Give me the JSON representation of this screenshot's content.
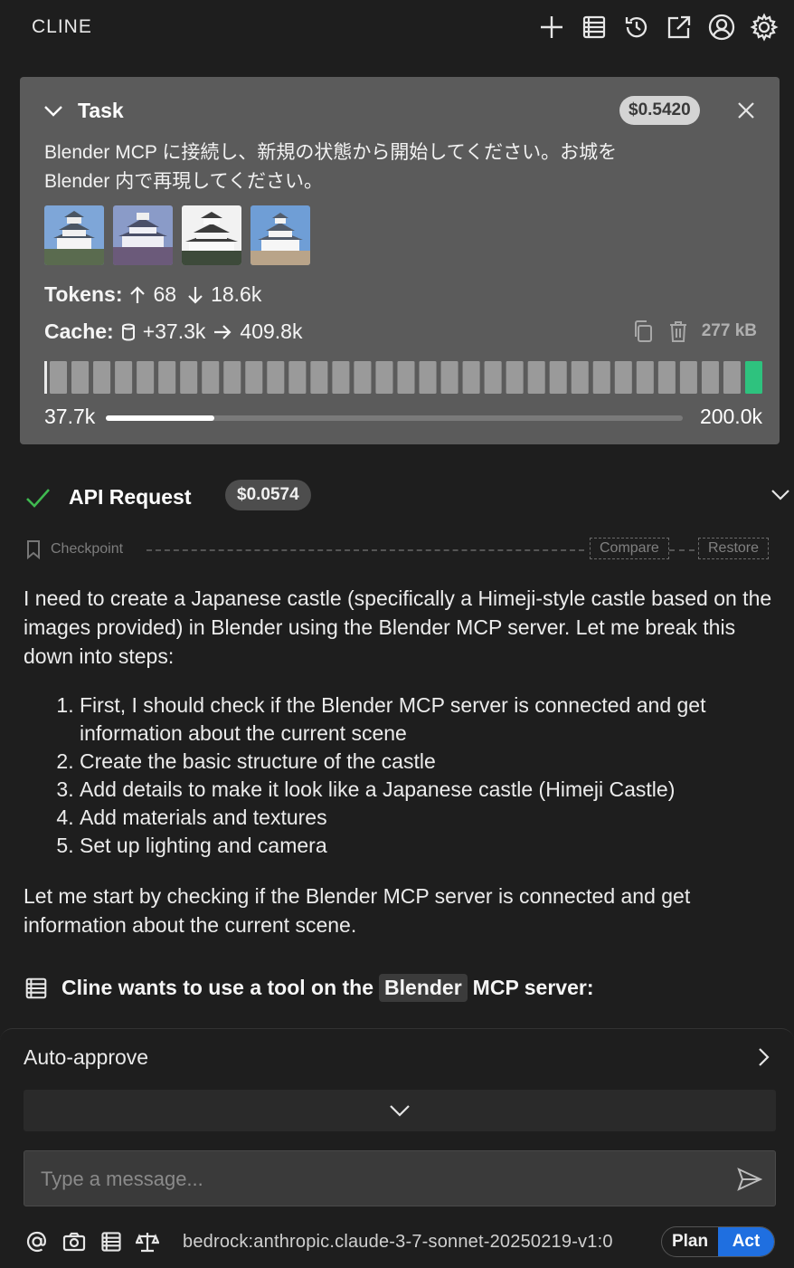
{
  "app": {
    "title": "CLINE"
  },
  "toolbar": {
    "icons": [
      "plus-icon",
      "mcp-servers-icon",
      "history-icon",
      "popout-icon",
      "account-icon",
      "settings-icon"
    ]
  },
  "task": {
    "header": "Task",
    "cost": "$0.5420",
    "text_line1": "Blender MCP に接続し、新規の状態から開始してください。お城を",
    "text_line2": "Blender 内で再現してください。",
    "tokens_label": "Tokens:",
    "tokens_in": "68",
    "tokens_out": "18.6k",
    "cache_label": "Cache:",
    "cache_write": "+37.3k",
    "cache_read": "409.8k",
    "size": "277 kB",
    "context_used": "37.7k",
    "context_total": "200.0k",
    "context_fraction": 0.188
  },
  "api_request": {
    "title": "API Request",
    "cost": "$0.0574"
  },
  "checkpoint": {
    "label": "Checkpoint",
    "compare": "Compare",
    "restore": "Restore"
  },
  "message": {
    "intro": "I need to create a Japanese castle (specifically a Himeji-style castle based on the images provided) in Blender using the Blender MCP server. Let me break this down into steps:",
    "steps": [
      "First, I should check if the Blender MCP server is connected and get information about the current scene",
      "Create the basic structure of the castle",
      "Add details to make it look like a Japanese castle (Himeji Castle)",
      "Add materials and textures",
      "Set up lighting and camera"
    ],
    "outro": "Let me start by checking if the Blender MCP server is connected and get information about the current scene."
  },
  "tool_use": {
    "prefix": "Cline wants to use a tool on the",
    "server": "Blender",
    "suffix": "MCP server:"
  },
  "bottom": {
    "auto_approve": "Auto-approve",
    "placeholder": "Type a message...",
    "model": "bedrock:anthropic.claude-3-7-sonnet-20250219-v1:0",
    "plan": "Plan",
    "act": "Act",
    "mode": "Act"
  }
}
